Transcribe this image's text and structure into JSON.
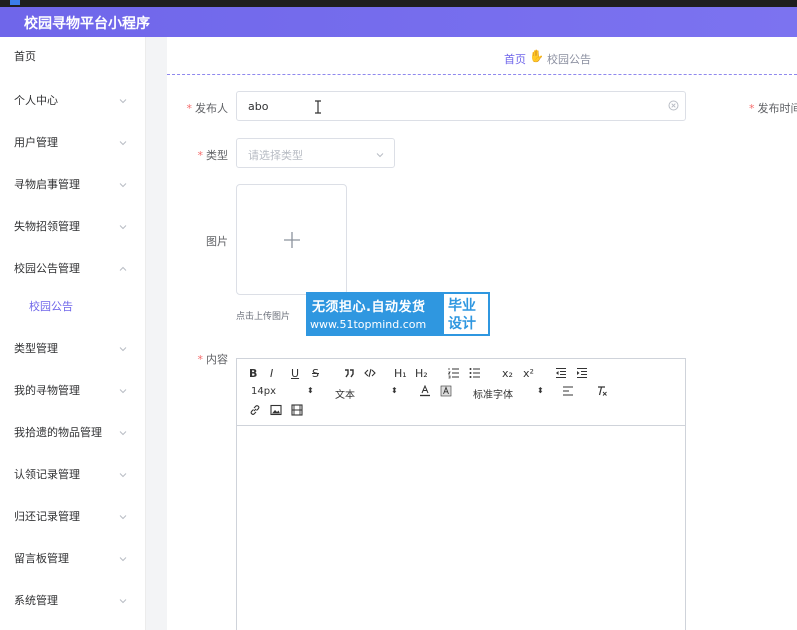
{
  "header": {
    "title": "校园寻物平台小程序"
  },
  "sidebar": {
    "items": [
      {
        "label": "首页"
      },
      {
        "label": "个人中心"
      },
      {
        "label": "用户管理"
      },
      {
        "label": "寻物启事管理"
      },
      {
        "label": "失物招领管理"
      },
      {
        "label": "校园公告管理"
      },
      {
        "label": "类型管理"
      },
      {
        "label": "我的寻物管理"
      },
      {
        "label": "我拾遗的物品管理"
      },
      {
        "label": "认领记录管理"
      },
      {
        "label": "归还记录管理"
      },
      {
        "label": "留言板管理"
      },
      {
        "label": "系统管理"
      }
    ],
    "subitem": {
      "label": "校园公告"
    }
  },
  "breadcrumb": {
    "home": "首页",
    "current": "校园公告"
  },
  "form": {
    "publisher": {
      "label": "发布人",
      "value": "abo"
    },
    "publish_time": {
      "label": "发布时间"
    },
    "type": {
      "label": "类型",
      "placeholder": "请选择类型"
    },
    "image": {
      "label": "图片",
      "tip": "点击上传图片"
    },
    "content": {
      "label": "内容"
    }
  },
  "watermark": {
    "line1": "无须担心.自动发货",
    "line2": "www.51topmind.com",
    "side": "毕业设计"
  },
  "editor": {
    "toolbar": {
      "bold": "B",
      "italic": "I",
      "underline": "U",
      "strike": "S",
      "h1": "H₁",
      "h2": "H₂",
      "sub": "x₂",
      "sup": "x²",
      "size": "14px",
      "header_select": "文本",
      "font_select": "标准字体"
    }
  },
  "colors": {
    "accent": "#6f66ea",
    "required": "#f56c6c",
    "watermark": "#2f97e0"
  }
}
